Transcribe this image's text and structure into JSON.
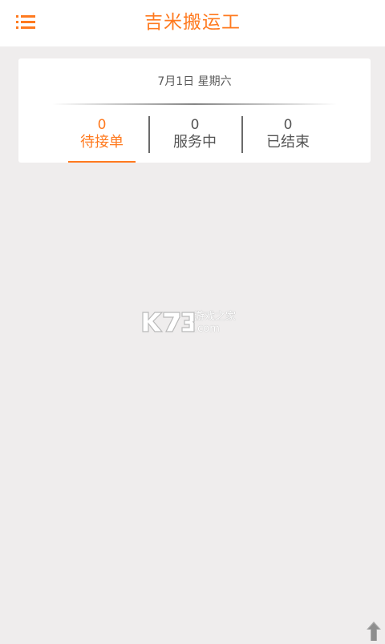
{
  "header": {
    "title": "吉米搬运工",
    "menu_icon": "list-menu-icon"
  },
  "colors": {
    "accent": "#ff7a1f",
    "background": "#efeded",
    "text": "#555555"
  },
  "summary": {
    "date": "7月1日 星期六",
    "tabs": [
      {
        "count": "0",
        "label": "待接单",
        "active": true
      },
      {
        "count": "0",
        "label": "服务中",
        "active": false
      },
      {
        "count": "0",
        "label": "已结束",
        "active": false
      }
    ]
  },
  "watermark": {
    "logo": "K73",
    "text": "游戏之家",
    "domain": ".com"
  },
  "scroll_top_icon": "arrow-up-icon"
}
